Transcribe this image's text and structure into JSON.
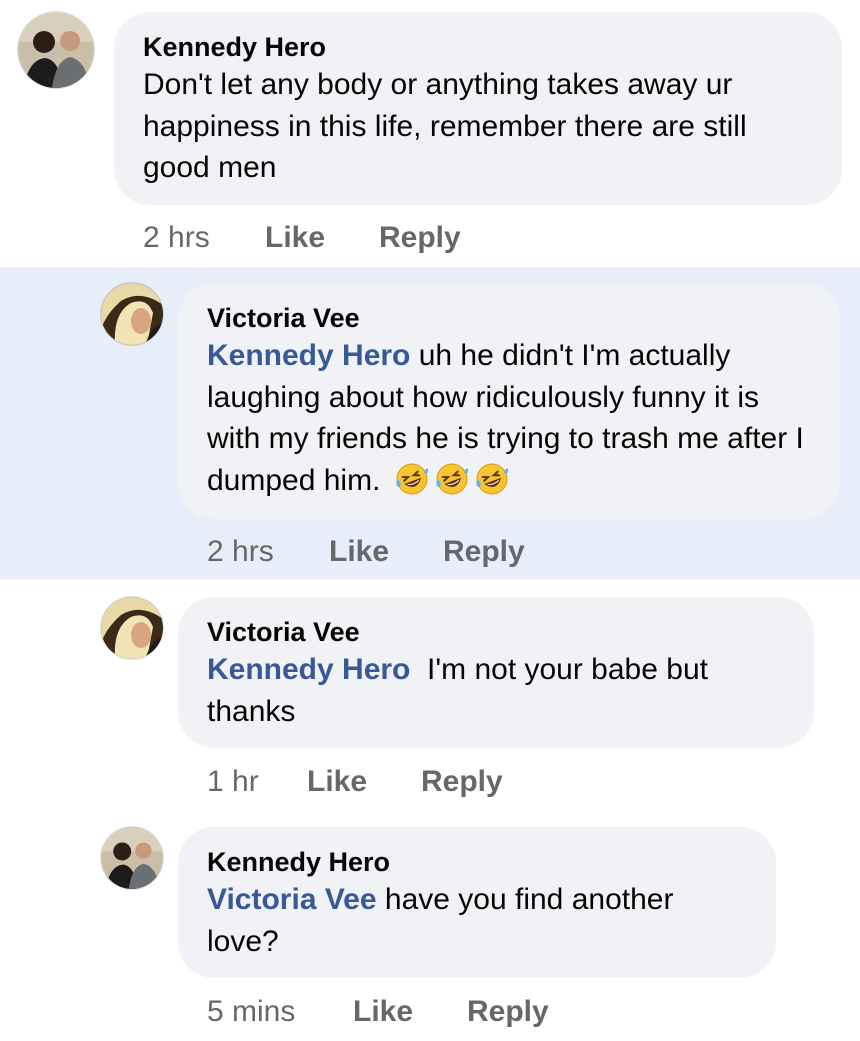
{
  "comments": [
    {
      "author": "Kennedy Hero",
      "text": "Don't let any body or anything takes away ur happiness in this life, remember there are still good men",
      "time": "2 hrs",
      "like": "Like",
      "reply": "Reply",
      "avatar_icon": "kennedy-hero-avatar"
    },
    {
      "author": "Victoria Vee",
      "mention": "Kennedy Hero",
      "text": " uh he didn't I'm actually laughing about how ridiculously funny it is with my friends he is trying to trash me after I dumped him.",
      "emojis": [
        "🤣",
        "🤣",
        "🤣"
      ],
      "time": "2 hrs",
      "like": "Like",
      "reply": "Reply",
      "highlighted": true,
      "avatar_icon": "victoria-vee-avatar"
    },
    {
      "author": "Victoria Vee",
      "mention": "Kennedy Hero",
      "text": "  I'm not your babe but thanks",
      "time": "1 hr",
      "like": "Like",
      "reply": "Reply",
      "avatar_icon": "victoria-vee-avatar"
    },
    {
      "author": "Kennedy Hero",
      "mention": "Victoria Vee",
      "text": " have you find another love?",
      "time": "5 mins",
      "like": "Like",
      "reply": "Reply",
      "avatar_icon": "kennedy-hero-avatar"
    }
  ],
  "colors": {
    "bubble": "#f0f2f5",
    "highlight": "#e7eefa",
    "mention": "#385898",
    "meta": "#65676b"
  }
}
